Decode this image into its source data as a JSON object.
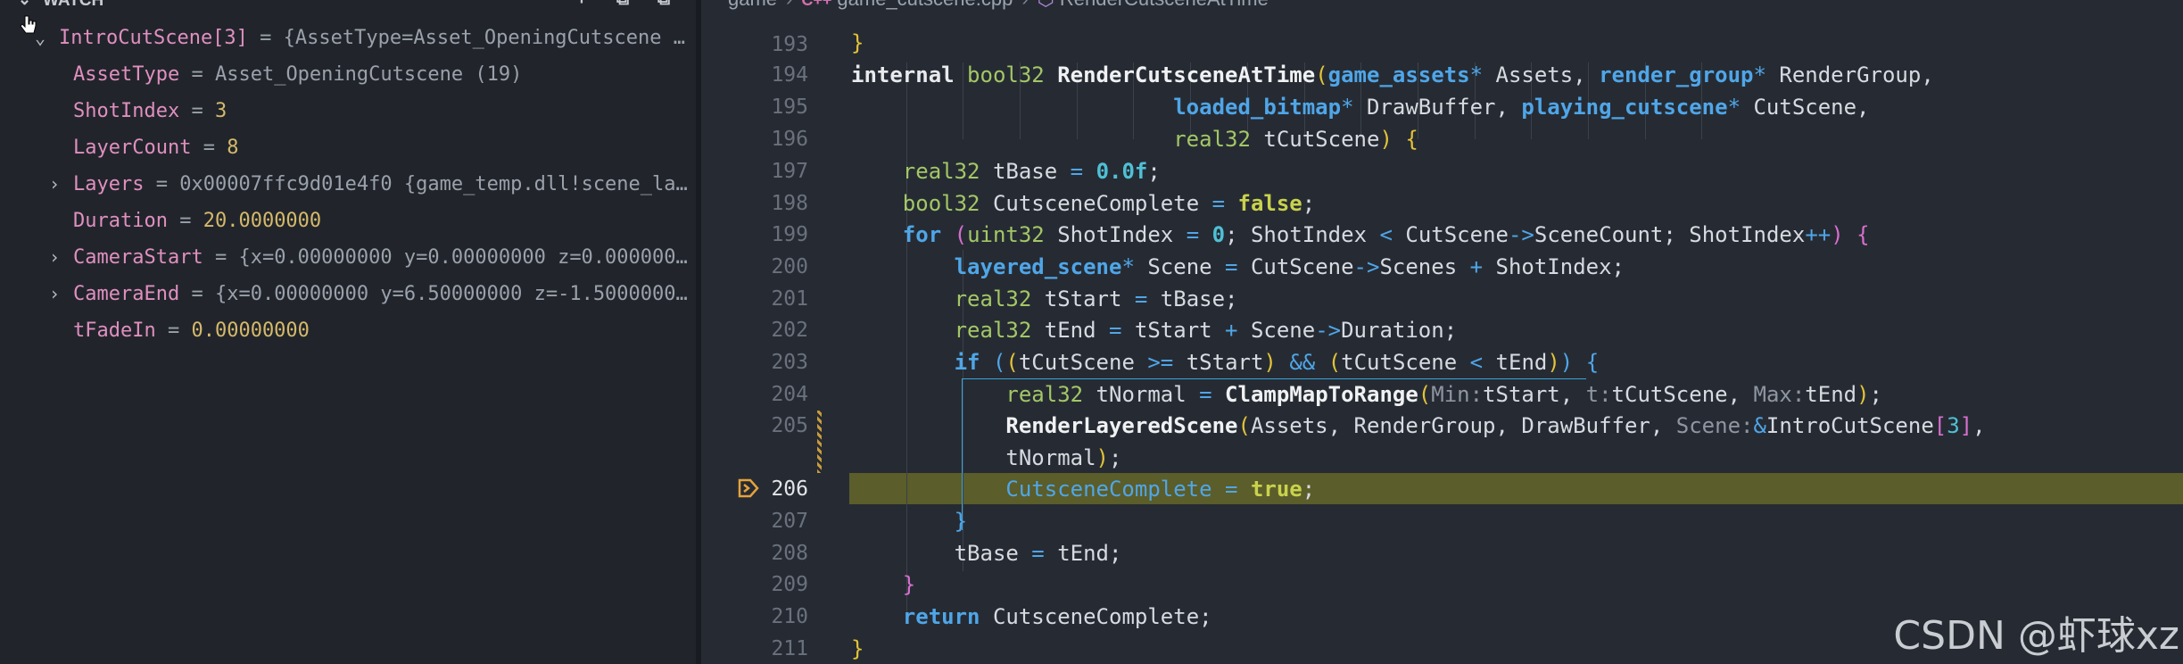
{
  "watch": {
    "title": "WATCH",
    "rows": [
      {
        "name": "IntroCutScene[3]",
        "eq": " = ",
        "value": "{AssetType=Asset_OpeningCutscene …"
      },
      {
        "name": "AssetType",
        "eq": " = ",
        "value": "Asset_OpeningCutscene (19)"
      },
      {
        "name": "ShotIndex",
        "eq": " = ",
        "value": "3"
      },
      {
        "name": "LayerCount",
        "eq": " = ",
        "value": "8"
      },
      {
        "name": "Layers",
        "eq": " = ",
        "value": "0x00007ffc9d01e4f0 {game_temp.dll!scene_la…"
      },
      {
        "name": "Duration",
        "eq": " = ",
        "value": "20.0000000"
      },
      {
        "name": "CameraStart",
        "eq": " = ",
        "value": "{x=0.00000000 y=0.00000000 z=0.000000…"
      },
      {
        "name": "CameraEnd",
        "eq": " = ",
        "value": "{x=0.00000000 y=6.50000000 z=-1.5000000…"
      },
      {
        "name": "tFadeIn",
        "eq": " = ",
        "value": "0.00000000"
      }
    ]
  },
  "breadcrumb": {
    "folder": "game",
    "file_icon": "C++",
    "file": "game_cutscene.cpp",
    "symbol": "RenderCutsceneAtTime"
  },
  "editor": {
    "line_numbers": [
      "193",
      "194",
      "195",
      "196",
      "197",
      "198",
      "199",
      "200",
      "201",
      "202",
      "203",
      "204",
      "205",
      "",
      "206",
      "207",
      "208",
      "209",
      "210",
      "211"
    ],
    "current_line": "206",
    "colors": {
      "current_line_bg": "#5b5d2a",
      "accent": "#4fa6e8"
    }
  },
  "watermark": "CSDN @虾球xz"
}
